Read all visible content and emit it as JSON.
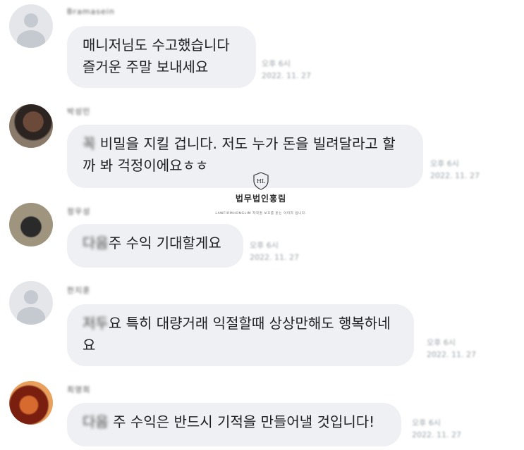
{
  "watermark": {
    "logo_text": "HL",
    "title": "법무법인홍림",
    "subtitle": "LAWFIRMHONGLIM 저작권 보호를 받는 이미지 입니다."
  },
  "messages": [
    {
      "sender": "Bramasein",
      "avatar": "default-avatar",
      "lines": [
        "매니저님도 수고했습니다",
        "즐거운 주말 보내세요"
      ],
      "timestamp": [
        "오후 6시",
        "2022. 11. 27"
      ]
    },
    {
      "sender": "박성민",
      "avatar": "photo-avatar",
      "lines_blur_prefix": "꼭",
      "lines": [
        " 비밀을 지킬 겁니다. 저도 누가 돈을 빌려달라고 할",
        "까 봐 걱정이에요ㅎㅎ"
      ],
      "timestamp": [
        "오후 6시",
        "2022. 11. 27"
      ]
    },
    {
      "sender": "정우성",
      "avatar": "photo-avatar",
      "lines_blur_prefix": "다음",
      "lines": [
        "주 수익 기대할게요"
      ],
      "timestamp": [
        "오후 6시",
        "2022. 11. 27"
      ]
    },
    {
      "sender": "한지훈",
      "avatar": "default-avatar",
      "lines_blur_prefix": "저두",
      "lines": [
        "요 특히 대량거래 익절할때 상상만해도 행복하네",
        "요"
      ],
      "timestamp": [
        "오후 6시",
        "2022. 11. 27"
      ]
    },
    {
      "sender": "최영희",
      "avatar": "photo-avatar",
      "lines_blur_prefix": "다음",
      "lines": [
        " 주 수익은 반드시 기적을 만들어낼 것입니다!"
      ],
      "timestamp": [
        "오후 6시",
        "2022. 11. 27"
      ]
    }
  ]
}
